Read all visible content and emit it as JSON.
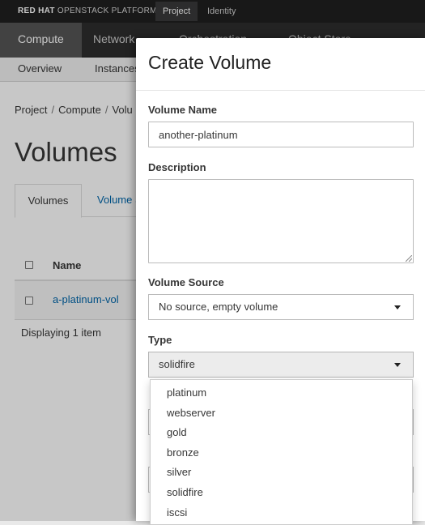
{
  "topbar": {
    "brand_bold": "RED HAT",
    "brand_rest": "OPENSTACK PLATFORM",
    "tabs": [
      {
        "label": "Project",
        "active": true
      },
      {
        "label": "Identity",
        "active": false
      }
    ]
  },
  "mainnav": {
    "items": [
      {
        "label": "Compute",
        "active": true
      },
      {
        "label": "Network",
        "active": false
      },
      {
        "label": "Orchestration",
        "active": false
      },
      {
        "label": "Object Store",
        "active": false
      }
    ]
  },
  "subnav": {
    "items": [
      {
        "label": "Overview"
      },
      {
        "label": "Instances"
      }
    ]
  },
  "breadcrumb": [
    "Project",
    "Compute",
    "Volu"
  ],
  "page": {
    "title": "Volumes",
    "tabs": [
      {
        "label": "Volumes",
        "active": true
      },
      {
        "label": "Volume S",
        "active": false
      }
    ],
    "table": {
      "header_name": "Name",
      "rows": [
        {
          "name": "a-platinum-vol"
        }
      ]
    },
    "footer": "Displaying 1 item"
  },
  "modal": {
    "title": "Create Volume",
    "volume_name": {
      "label": "Volume Name",
      "value": "another-platinum"
    },
    "description": {
      "label": "Description",
      "value": ""
    },
    "volume_source": {
      "label": "Volume Source",
      "selected": "No source, empty volume"
    },
    "type": {
      "label": "Type",
      "selected": "solidfire",
      "options": [
        "platinum",
        "webserver",
        "gold",
        "bronze",
        "silver",
        "solidfire",
        "iscsi"
      ]
    }
  },
  "colors": {
    "link": "#0066aa",
    "topbar": "#1f1f1f",
    "nav": "#2e2e2e"
  }
}
